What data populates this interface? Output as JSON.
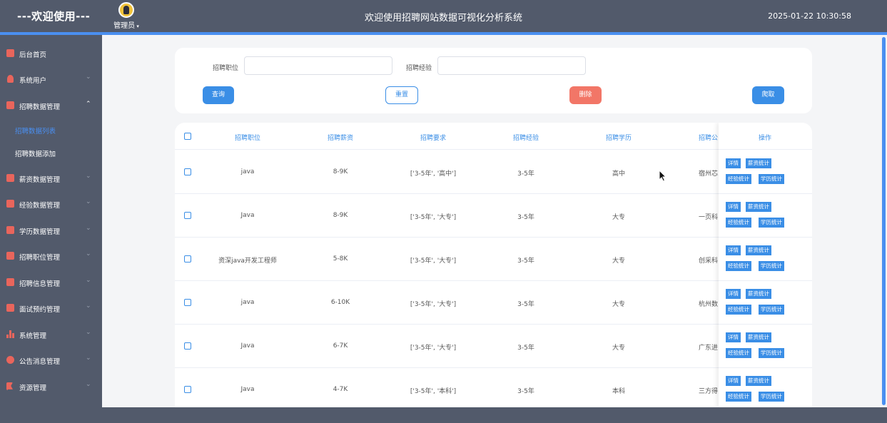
{
  "header": {
    "brand": "---欢迎使用---",
    "user_label": "管理员",
    "system_title": "欢迎使用招聘网站数据可视化分析系统",
    "datetime": "2025-01-22 10:30:58"
  },
  "sidebar": {
    "items": [
      {
        "label": "后台首页",
        "icon": "monitor-icon"
      },
      {
        "label": "系统用户",
        "icon": "person-icon"
      },
      {
        "label": "招聘数据管理",
        "icon": "check-square-icon",
        "expanded": true
      },
      {
        "label": "薪资数据管理",
        "icon": "check-square-icon"
      },
      {
        "label": "经验数据管理",
        "icon": "check-square-icon"
      },
      {
        "label": "学历数据管理",
        "icon": "check-square-icon"
      },
      {
        "label": "招聘职位管理",
        "icon": "check-square-icon"
      },
      {
        "label": "招聘信息管理",
        "icon": "check-square-icon"
      },
      {
        "label": "面试预约管理",
        "icon": "check-square-icon"
      },
      {
        "label": "系统管理",
        "icon": "bar-chart-icon"
      },
      {
        "label": "公告消息管理",
        "icon": "alert-circle-icon"
      },
      {
        "label": "资源管理",
        "icon": "flag-icon"
      }
    ],
    "subitems": [
      {
        "label": "招聘数据列表",
        "active": true
      },
      {
        "label": "招聘数据添加",
        "active": false
      }
    ],
    "accent_color": "#4a8ff0",
    "icon_color": "#e9655c"
  },
  "search": {
    "position_label": "招聘职位",
    "position_value": "",
    "experience_label": "招聘经验",
    "experience_value": "",
    "query_button": "查询",
    "reset_button": "重置",
    "delete_button": "删除",
    "crawl_button": "爬取"
  },
  "table": {
    "columns": [
      "招聘职位",
      "招聘薪资",
      "招聘要求",
      "招聘经验",
      "招聘学历",
      "招聘公",
      "操作"
    ],
    "rows": [
      {
        "position": "java",
        "salary": "8-9K",
        "requirement": "['3-5年', '高中']",
        "experience": "3-5年",
        "education": "高中",
        "company": "宿州芯"
      },
      {
        "position": "Java",
        "salary": "8-9K",
        "requirement": "['3-5年', '大专']",
        "experience": "3-5年",
        "education": "大专",
        "company": "一页科"
      },
      {
        "position": "资深java开发工程师",
        "salary": "5-8K",
        "requirement": "['3-5年', '大专']",
        "experience": "3-5年",
        "education": "大专",
        "company": "创采科"
      },
      {
        "position": "java",
        "salary": "6-10K",
        "requirement": "['3-5年', '大专']",
        "experience": "3-5年",
        "education": "大专",
        "company": "杭州数"
      },
      {
        "position": "Java",
        "salary": "6-7K",
        "requirement": "['3-5年', '大专']",
        "experience": "3-5年",
        "education": "大专",
        "company": "广东进"
      },
      {
        "position": "Java",
        "salary": "4-7K",
        "requirement": "['3-5年', '本科']",
        "experience": "3-5年",
        "education": "本科",
        "company": "三方得"
      }
    ],
    "actions": [
      "详情",
      "薪资统计",
      "经验统计",
      "学历统计"
    ],
    "header_color": "#3a8ee6"
  }
}
